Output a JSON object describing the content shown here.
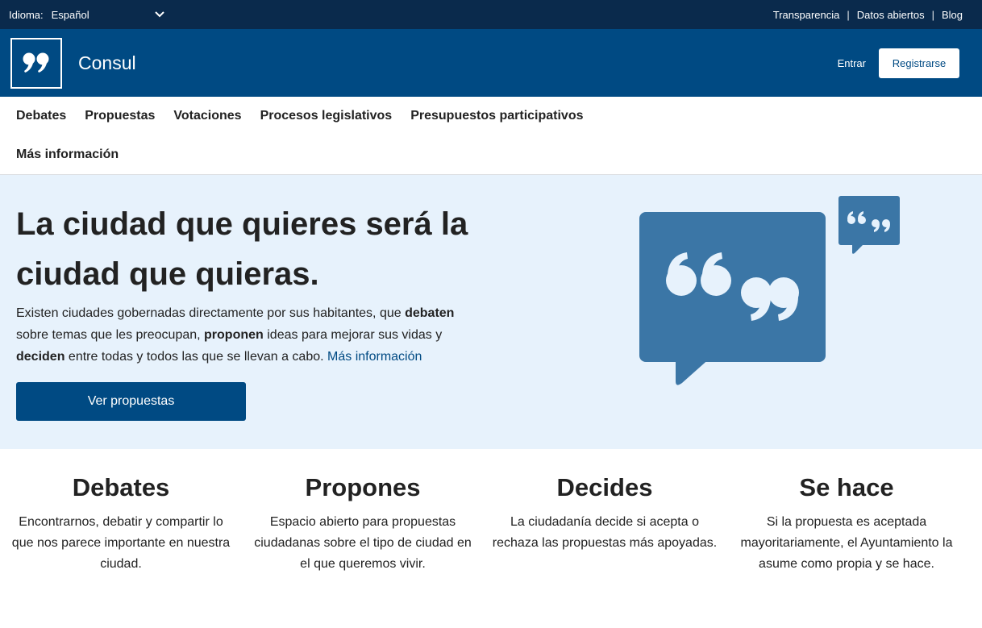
{
  "topbar": {
    "language_label": "Idioma:",
    "language_value": "Español",
    "links": [
      "Transparencia",
      "Datos abiertos",
      "Blog"
    ],
    "separator": "|"
  },
  "header": {
    "brand": "Consul",
    "login": "Entrar",
    "register": "Registrarse"
  },
  "nav": {
    "row1": [
      "Debates",
      "Propuestas",
      "Votaciones",
      "Procesos legislativos",
      "Presupuestos participativos"
    ],
    "row2": [
      "Más información"
    ]
  },
  "hero": {
    "title": "La ciudad que quieres será la ciudad que quieras.",
    "text_1": "Existen ciudades gobernadas directamente por sus habitantes, que ",
    "bold_1": "debaten",
    "text_2": " sobre temas que les preocupan, ",
    "bold_2": "proponen",
    "text_3": " ideas para mejorar sus vidas y ",
    "bold_3": "deciden",
    "text_4": " entre todas y todos las que se llevan a cabo. ",
    "more_link": "Más información",
    "cta": "Ver propuestas"
  },
  "features": [
    {
      "title": "Debates",
      "text": "Encontrarnos, debatir y compartir lo que nos parece importante en nuestra ciudad."
    },
    {
      "title": "Propones",
      "text": "Espacio abierto para propuestas ciudadanas sobre el tipo de ciudad en el que queremos vivir."
    },
    {
      "title": "Decides",
      "text": "La ciudadanía decide si acepta o rechaza las propuestas más apoyadas."
    },
    {
      "title": "Se hace",
      "text": "Si la propuesta es aceptada mayoritariamente, el Ayuntamiento la asume como propia y se hace."
    }
  ],
  "colors": {
    "topbar": "#0a2a4c",
    "header": "#004a83",
    "hero_bg": "#e7f2fc",
    "bubble": "#3b76a6"
  },
  "icons": {
    "language_dropdown": "chevron-down-icon",
    "logo": "quote-logo-icon",
    "illustration": "speech-bubble-quotes-icon"
  }
}
